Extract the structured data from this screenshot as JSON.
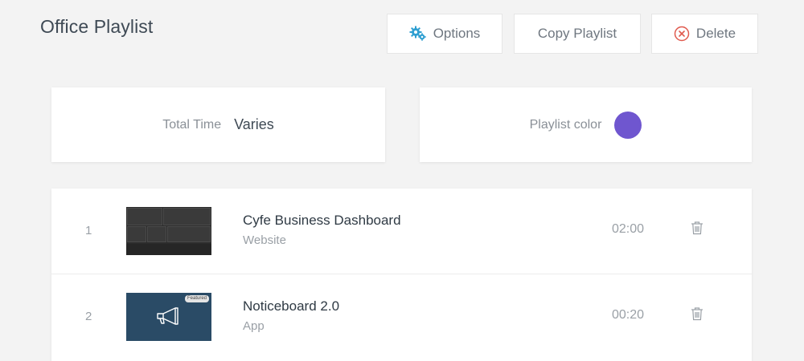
{
  "header": {
    "title": "Office Playlist",
    "options_label": "Options",
    "copy_label": "Copy Playlist",
    "delete_label": "Delete"
  },
  "summary": {
    "total_time_label": "Total Time",
    "total_time_value": "Varies",
    "color_label": "Playlist color",
    "color_value": "#6f56cf"
  },
  "items": [
    {
      "index": "1",
      "name": "Cyfe Business Dashboard",
      "type": "Website",
      "duration": "02:00",
      "thumbnail": "dashboard"
    },
    {
      "index": "2",
      "name": "Noticeboard 2.0",
      "type": "App",
      "duration": "00:20",
      "thumbnail": "noticeboard",
      "badge": "Featured"
    }
  ],
  "colors": {
    "accent_icon": "#2f9fd1",
    "delete_icon": "#e05a4e",
    "playlist_color": "#6f56cf"
  }
}
